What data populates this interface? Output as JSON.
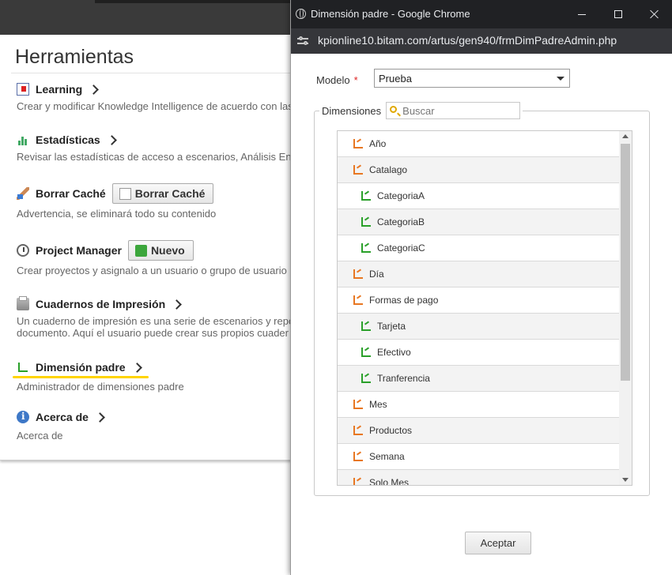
{
  "background": {
    "panel_title": "Herramientas",
    "tools": [
      {
        "label": "Learning",
        "desc": "Crear y modificar Knowledge Intelligence de acuerdo con las",
        "icon": "learning-icon"
      },
      {
        "label": "Estadísticas",
        "desc": "Revisar las estadísticas de acceso a escenarios, Análisis En",
        "icon": "stats-icon"
      },
      {
        "label": "Borrar Caché",
        "button": "Borrar Caché",
        "desc": "Advertencia, se eliminará todo su contenido",
        "icon": "broom-icon"
      },
      {
        "label": "Project Manager",
        "button": "Nuevo",
        "desc": "Crear proyectos y asignalo a un usuario o grupo de usuario",
        "icon": "clock-icon"
      },
      {
        "label": "Cuadernos de Impresión",
        "desc": "Un cuaderno de impresión es una serie de escenarios y repo",
        "desc2": "documento. Aquí el usuario puede crear sus propios cuader",
        "icon": "printer-icon"
      },
      {
        "label": "Dimensión padre",
        "desc": "Administrador de dimensiones padre",
        "icon": "dimension-icon"
      },
      {
        "label": "Acerca de",
        "desc": "Acerca de",
        "icon": "info-icon"
      }
    ]
  },
  "popup": {
    "window_title": "Dimensión padre - Google Chrome",
    "url": "kpionline10.bitam.com/artus/gen940/frmDimPadreAdmin.php",
    "modelo_label": "Modelo",
    "required_mark": "*",
    "modelo_value": "Prueba",
    "dimensiones_label": "Dimensiones",
    "search_placeholder": "Buscar",
    "items": [
      {
        "label": "Año",
        "level": 0
      },
      {
        "label": "Catalago",
        "level": 0
      },
      {
        "label": "CategoriaA",
        "level": 1
      },
      {
        "label": "CategoriaB",
        "level": 1
      },
      {
        "label": "CategoriaC",
        "level": 1
      },
      {
        "label": "Día",
        "level": 0
      },
      {
        "label": "Formas de pago",
        "level": 0
      },
      {
        "label": "Tarjeta",
        "level": 1
      },
      {
        "label": "Efectivo",
        "level": 1
      },
      {
        "label": "Tranferencia",
        "level": 1
      },
      {
        "label": "Mes",
        "level": 0
      },
      {
        "label": "Productos",
        "level": 0
      },
      {
        "label": "Semana",
        "level": 0
      },
      {
        "label": "Solo Mes",
        "level": 0
      }
    ],
    "accept_label": "Aceptar"
  },
  "colors": {
    "parent_icon": "#e87722",
    "child_icon": "#2aa02a",
    "highlight_underline": "#ffd400",
    "titlebar": "#202124"
  }
}
